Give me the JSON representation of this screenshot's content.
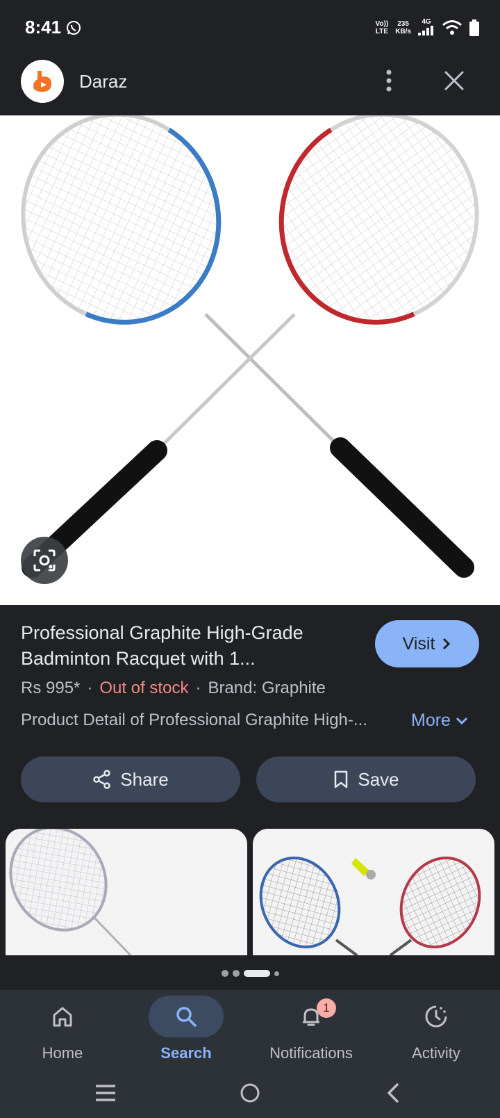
{
  "status_bar": {
    "time": "8:41",
    "net_line1": "Vo))",
    "net_line2": "LTE",
    "speed_value": "235",
    "speed_unit": "KB/s",
    "network": "4G",
    "icons": [
      "whatsapp-icon",
      "signal-icon",
      "wifi-icon",
      "battery-icon"
    ]
  },
  "app_bar": {
    "title": "Daraz",
    "icons": [
      "daraz-logo",
      "more-vert-icon",
      "close-icon"
    ]
  },
  "product": {
    "title": "Professional Graphite High-Grade Badminton Racquet with 1...",
    "visit_label": "Visit",
    "price": "Rs 995*",
    "stock_status": "Out of stock",
    "brand": "Brand: Graphite",
    "description": "Product Detail of Professional Graphite High-...",
    "more_label": "More"
  },
  "actions": {
    "share_label": "Share",
    "save_label": "Save"
  },
  "colors": {
    "accent": "#8ab4f8",
    "stock_red": "#f28b82",
    "background": "#202124",
    "pill": "#3c4658"
  },
  "carousel": {
    "pages": 4,
    "active_index": 2
  },
  "bottom_nav": {
    "items": [
      {
        "label": "Home",
        "icon": "home-icon"
      },
      {
        "label": "Search",
        "icon": "search-icon",
        "active": true
      },
      {
        "label": "Notifications",
        "icon": "bell-icon",
        "badge": "1"
      },
      {
        "label": "Activity",
        "icon": "activity-icon"
      }
    ]
  },
  "system_nav": [
    "recents-icon",
    "home-circle-icon",
    "back-icon"
  ]
}
